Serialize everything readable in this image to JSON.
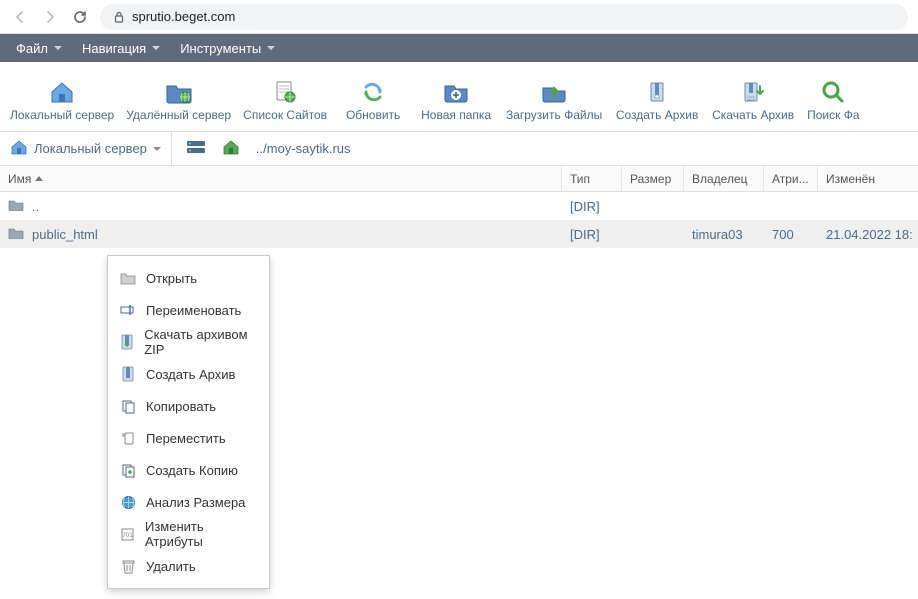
{
  "browser": {
    "url": "sprutio.beget.com"
  },
  "menus": {
    "file": "Файл",
    "nav": "Навигация",
    "tools": "Инструменты"
  },
  "toolbar": {
    "local": "Локальный сервер",
    "remote": "Удалённый сервер",
    "sites": "Список Сайтов",
    "refresh": "Обновить",
    "newfolder": "Новая папка",
    "upload": "Загрузить Файлы",
    "createarch": "Создать Архив",
    "downloadarch": "Скачать Архив",
    "search": "Поиск Фа"
  },
  "path": {
    "server_label": "Локальный сервер",
    "breadcrumb": "../moy-saytik.rus"
  },
  "columns": {
    "name": "Имя",
    "type": "Тип",
    "size": "Размер",
    "owner": "Владелец",
    "attr": "Атри...",
    "date": "Изменён"
  },
  "rows": [
    {
      "name": "..",
      "type": "[DIR]",
      "size": "",
      "owner": "",
      "attr": "",
      "date": ""
    },
    {
      "name": "public_html",
      "type": "[DIR]",
      "size": "",
      "owner": "timura03",
      "attr": "700",
      "date": "21.04.2022 18:"
    }
  ],
  "context": {
    "open": "Открыть",
    "rename": "Переименовать",
    "downloadzip": "Скачать архивом ZIP",
    "createarch": "Создать Архив",
    "copy": "Копировать",
    "move": "Переместить",
    "dup": "Создать Копию",
    "size": "Анализ Размера",
    "chmod": "Изменить Атрибуты",
    "delete": "Удалить"
  }
}
